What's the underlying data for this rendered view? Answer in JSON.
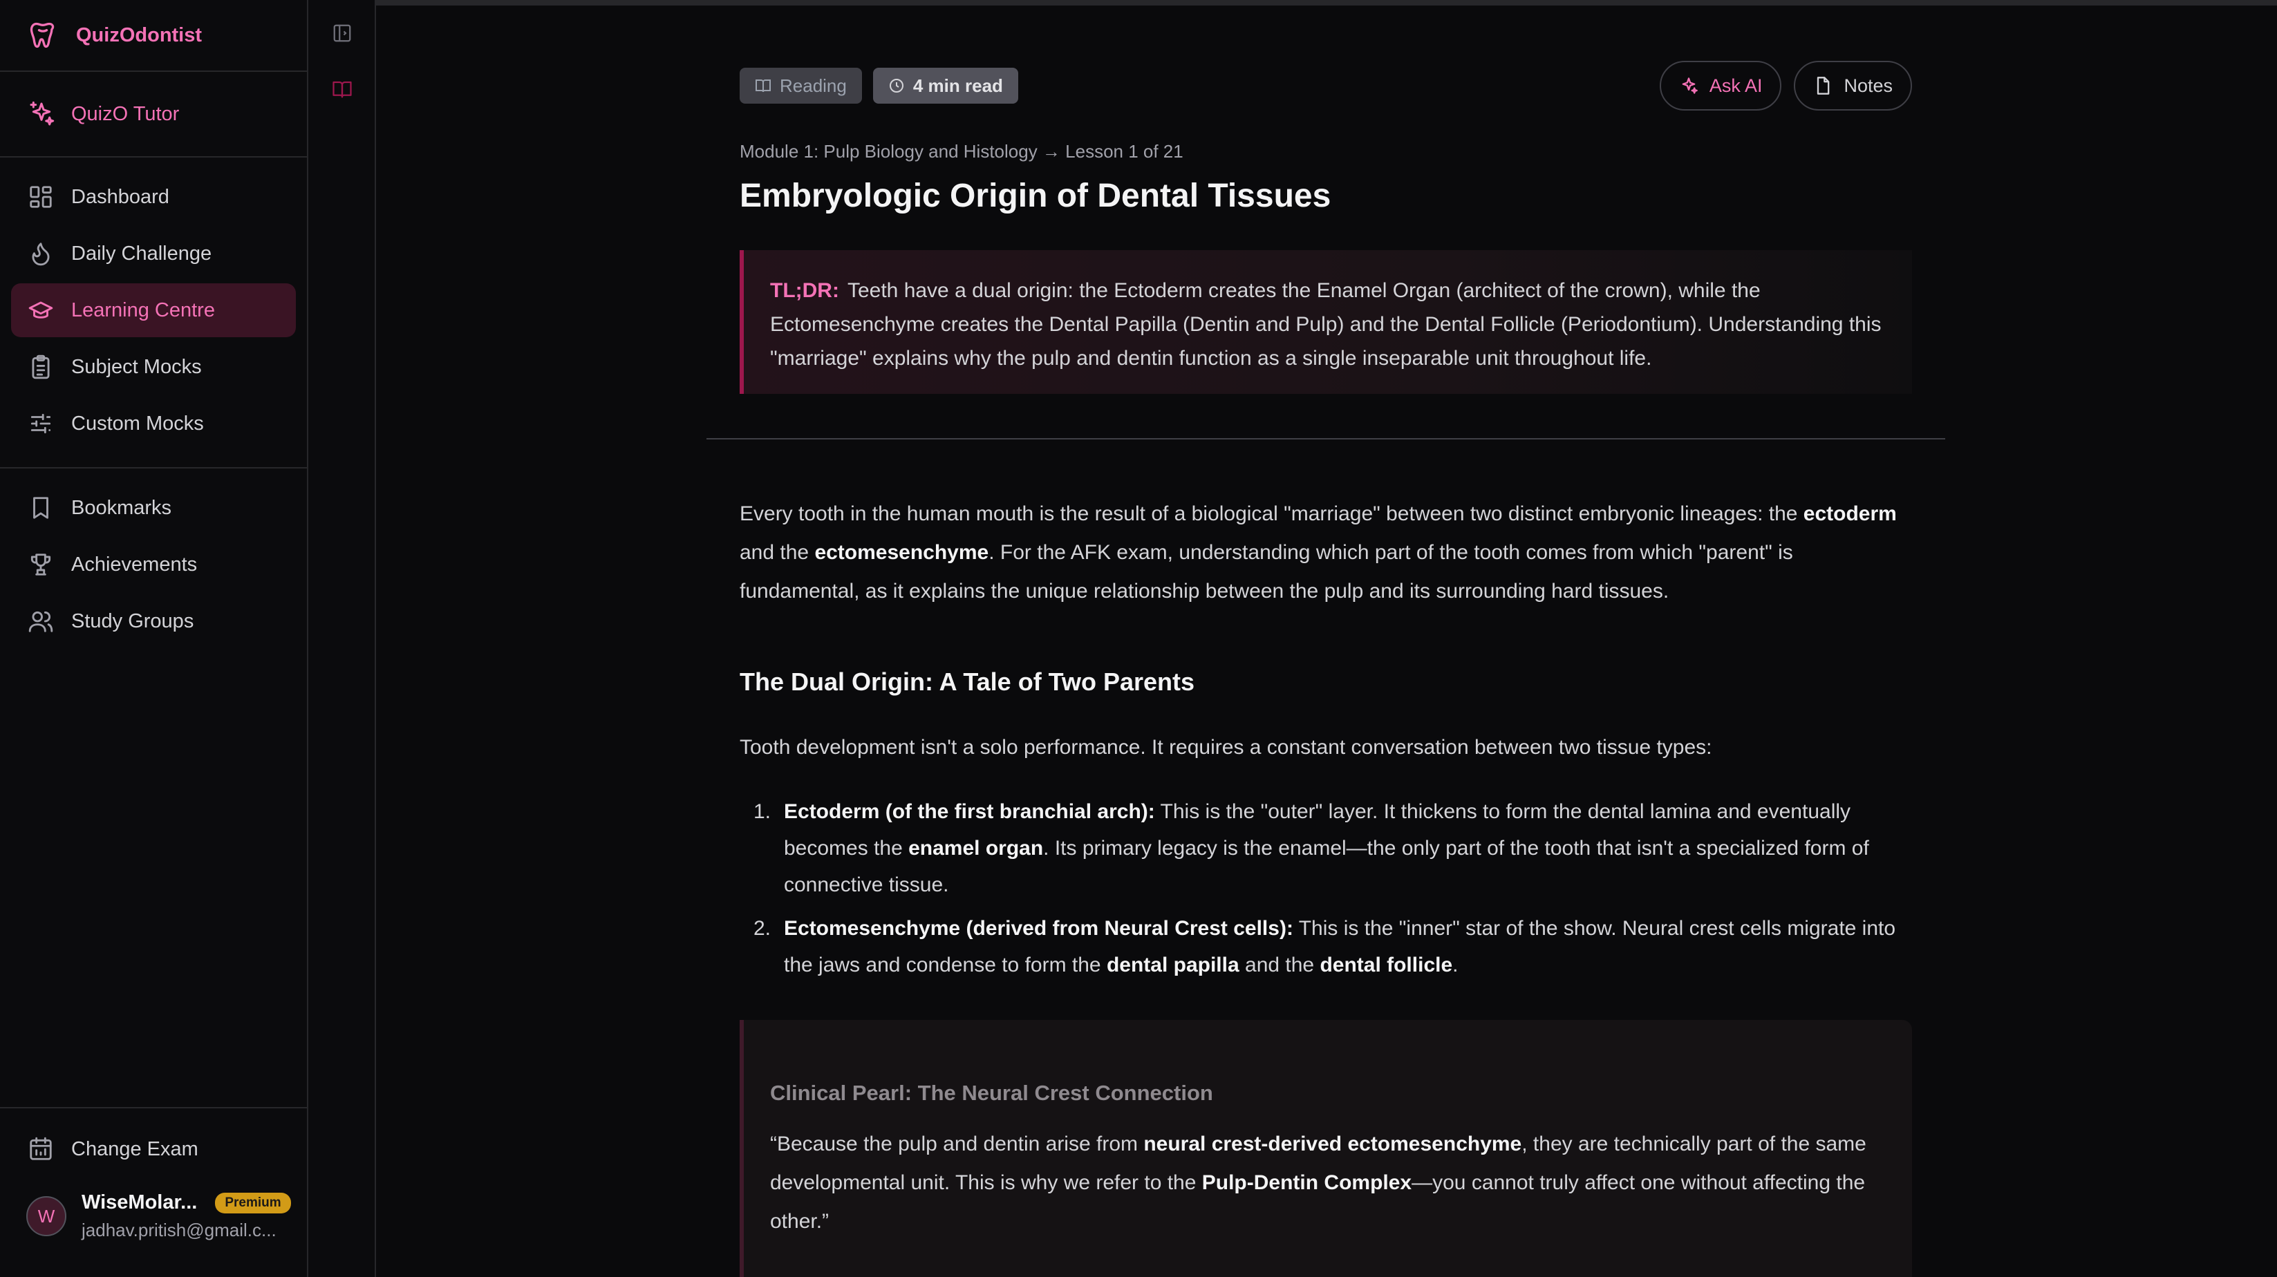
{
  "brand": {
    "name": "QuizOdontist"
  },
  "tutor": {
    "label": "QuizO Tutor"
  },
  "nav": {
    "items": [
      {
        "label": "Dashboard",
        "icon": "dashboard-icon"
      },
      {
        "label": "Daily Challenge",
        "icon": "flame-icon"
      },
      {
        "label": "Learning Centre",
        "icon": "graduation-cap-icon",
        "active": true
      },
      {
        "label": "Subject Mocks",
        "icon": "clipboard-icon"
      },
      {
        "label": "Custom Mocks",
        "icon": "sliders-icon"
      }
    ],
    "secondary": [
      {
        "label": "Bookmarks",
        "icon": "bookmark-icon"
      },
      {
        "label": "Achievements",
        "icon": "trophy-icon"
      },
      {
        "label": "Study Groups",
        "icon": "users-icon"
      }
    ]
  },
  "footer": {
    "change_exam": "Change Exam",
    "user": {
      "initial": "W",
      "name": "WiseMolar...",
      "badge": "Premium",
      "email": "jadhav.pritish@gmail.c..."
    }
  },
  "lesson": {
    "badges": {
      "type": "Reading",
      "time": "4 min read"
    },
    "actions": {
      "ask_ai": "Ask AI",
      "notes": "Notes"
    },
    "breadcrumb": "Module 1: Pulp Biology and Histology → Lesson 1 of 21",
    "title": "Embryologic Origin of Dental Tissues",
    "tldr": {
      "label": "TL;DR:",
      "text": "Teeth have a dual origin: the Ectoderm creates the Enamel Organ (architect of the crown), while the Ectomesenchyme creates the Dental Papilla (Dentin and Pulp) and the Dental Follicle (Periodontium). Understanding this \"marriage\" explains why the pulp and dentin function as a single inseparable unit throughout life."
    },
    "intro": {
      "part1": "Every tooth in the human mouth is the result of a biological \"marriage\" between two distinct embryonic lineages: the ",
      "bold1": "ectoderm",
      "part2": " and the ",
      "bold2": "ectomesenchyme",
      "part3": ". For the AFK exam, understanding which part of the tooth comes from which \"parent\" is fundamental, as it explains the unique relationship between the pulp and its surrounding hard tissues."
    },
    "section_heading": "The Dual Origin: A Tale of Two Parents",
    "section_intro": "Tooth development isn't a solo performance. It requires a constant conversation between two tissue types:",
    "list": [
      {
        "num": "1.",
        "bold": "Ectoderm (of the first branchial arch):",
        "text1": " This is the \"outer\" layer. It thickens to form the dental lamina and eventually becomes the ",
        "bold2": "enamel organ",
        "text2": ". Its primary legacy is the enamel—the only part of the tooth that isn't a specialized form of connective tissue.",
        "bold3": "",
        "text3": ""
      },
      {
        "num": "2.",
        "bold": "Ectomesenchyme (derived from Neural Crest cells):",
        "text1": " This is the \"inner\" star of the show. Neural crest cells migrate into the jaws and condense to form the ",
        "bold2": "dental papilla",
        "text2": " and the ",
        "bold3": "dental follicle",
        "text3": "."
      }
    ],
    "pearl": {
      "title": "Clinical Pearl: The Neural Crest Connection",
      "part1": "“Because the pulp and dentin arise from ",
      "bold1": "neural crest-derived ectomesenchyme",
      "part2": ", they are technically part of the same developmental unit. This is why we refer to the ",
      "bold2": "Pulp-Dentin Complex",
      "part3": "—you cannot truly affect one without affecting the other.”"
    }
  },
  "colors": {
    "accent": "#f472b6",
    "active_bg": "#3a1424",
    "premium": "#d29b17"
  }
}
